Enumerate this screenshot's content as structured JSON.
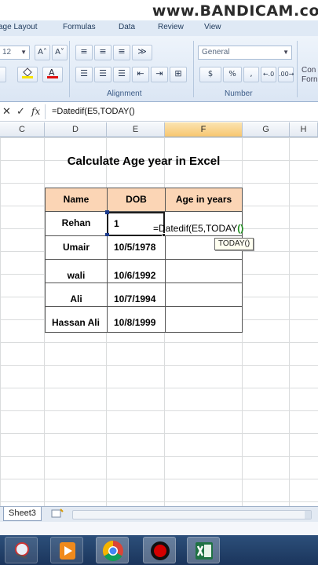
{
  "watermark": "www.BANDICAM.co",
  "ribbon": {
    "tabs": [
      "age Layout",
      "Formulas",
      "Data",
      "Review",
      "View"
    ],
    "font_size": "12",
    "number_format": "General",
    "groups": {
      "alignment": "Alignment",
      "number": "Number"
    },
    "glyphs": {
      "grow_font": "A˄",
      "shrink_font": "A˅",
      "currency": "$",
      "percent": "%",
      "comma": ",",
      "inc_decimal": "←.0",
      "dec_decimal": ".00→",
      "cond_format_1": "Con",
      "cond_format_2": "Forn"
    }
  },
  "formula_bar": {
    "cancel_glyph": "✕",
    "enter_glyph": "✓",
    "fx_label": "fx",
    "text": "=Datedif(E5,TODAY()"
  },
  "columns": [
    "C",
    "D",
    "E",
    "F",
    "G",
    "H"
  ],
  "sheet": {
    "title": "Calculate Age year  in Excel",
    "headers": [
      "Name",
      "DOB",
      "Age in years"
    ],
    "rows": [
      {
        "name": "Rehan",
        "dob": "1",
        "age": ""
      },
      {
        "name": "Umair",
        "dob": "10/5/1978",
        "age": ""
      },
      {
        "name": "wali",
        "dob": "10/6/1992",
        "age": ""
      },
      {
        "name": "Ali",
        "dob": "10/7/1994",
        "age": ""
      },
      {
        "name": "Hassan Ali",
        "dob": "10/8/1999",
        "age": ""
      }
    ],
    "editing_text_main": "=Datedif(E5,TODAY",
    "editing_paren": "()",
    "tooltip": "TODAY()"
  },
  "sheet_tabs": {
    "active": "Sheet3"
  },
  "taskbar": {
    "apps": [
      "snipping-tool-icon",
      "media-player-icon",
      "chrome-icon",
      "bandicam-record-icon",
      "excel-icon"
    ],
    "colors": {
      "chrome": "#4285f4",
      "record": "#d40000",
      "excel": "#1f7244"
    }
  }
}
